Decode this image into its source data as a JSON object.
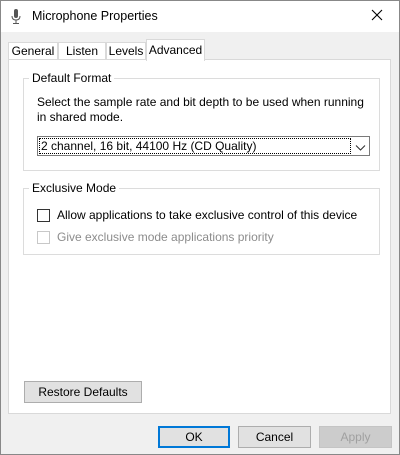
{
  "window": {
    "title": "Microphone Properties",
    "icons": {
      "app": "microphone-icon",
      "close": "close-icon"
    }
  },
  "tabs": [
    {
      "label": "General",
      "active": false
    },
    {
      "label": "Listen",
      "active": false
    },
    {
      "label": "Levels",
      "active": false
    },
    {
      "label": "Advanced",
      "active": true
    }
  ],
  "default_format": {
    "group_label": "Default Format",
    "description": "Select the sample rate and bit depth to be used when running in shared mode.",
    "selected_value": "2 channel, 16 bit, 44100 Hz (CD Quality)"
  },
  "exclusive_mode": {
    "group_label": "Exclusive Mode",
    "allow_exclusive": {
      "label": "Allow applications to take exclusive control of this device",
      "checked": false,
      "enabled": true
    },
    "give_priority": {
      "label": "Give exclusive mode applications priority",
      "checked": false,
      "enabled": false
    }
  },
  "buttons": {
    "restore_defaults": "Restore Defaults",
    "ok": "OK",
    "cancel": "Cancel",
    "apply": "Apply"
  },
  "colors": {
    "focus_border": "#0078d7",
    "disabled_text": "#8c8c8c"
  }
}
